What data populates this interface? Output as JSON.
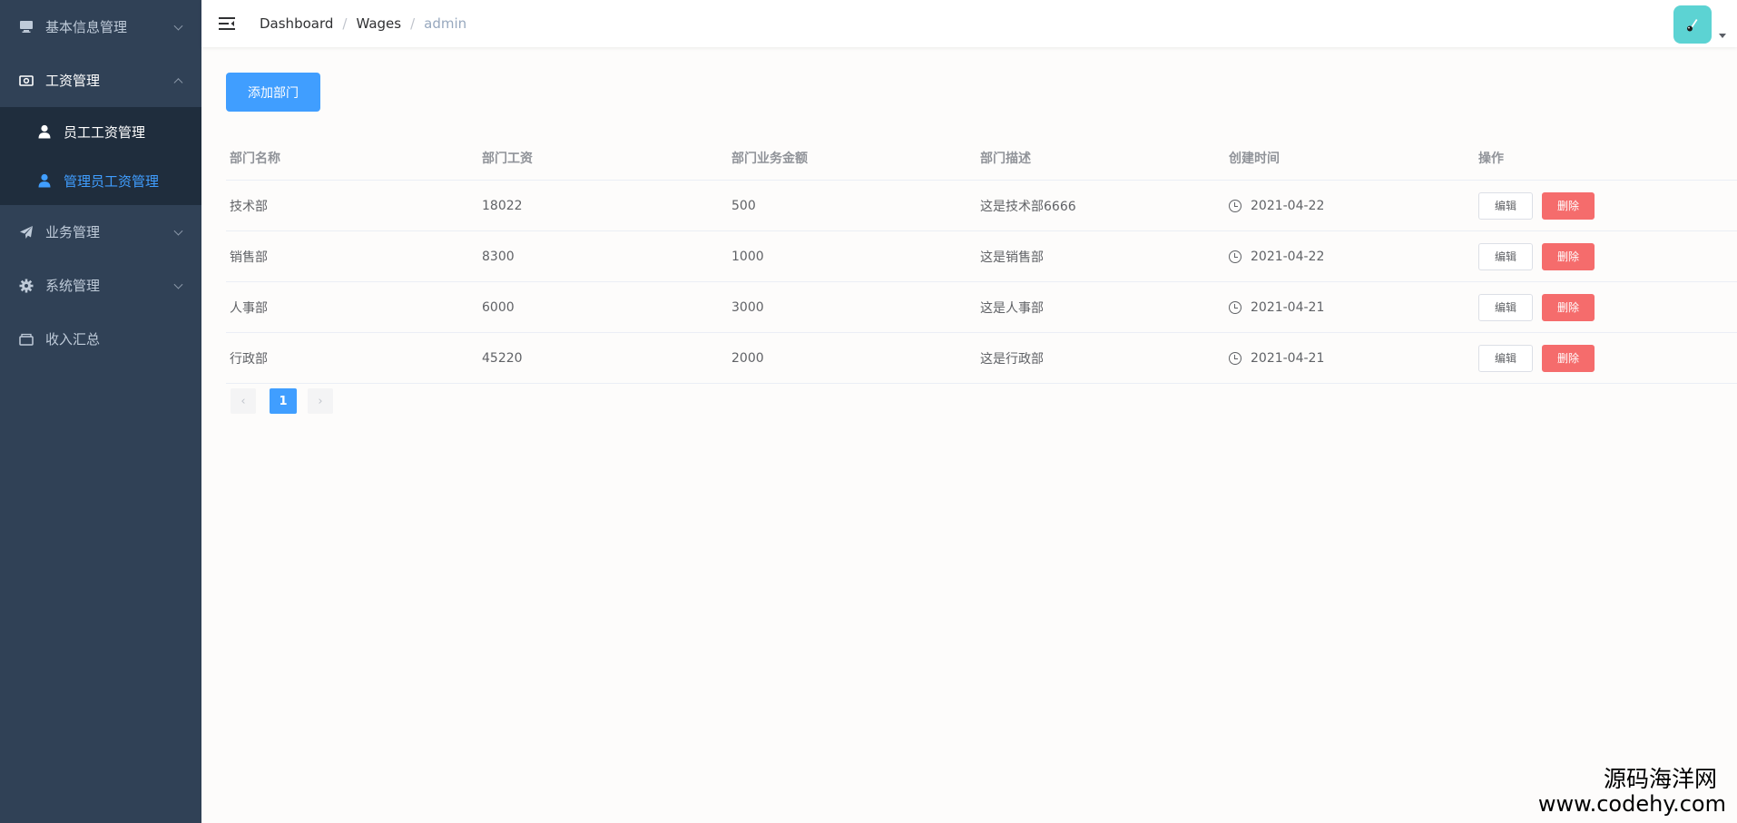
{
  "sidebar": {
    "items": [
      {
        "label": "基本信息管理",
        "icon": "monitor-icon"
      },
      {
        "label": "工资管理",
        "icon": "money-icon"
      },
      {
        "label": "员工工资管理",
        "icon": "user-icon"
      },
      {
        "label": "管理员工资管理",
        "icon": "user-icon"
      },
      {
        "label": "业务管理",
        "icon": "send-icon"
      },
      {
        "label": "系统管理",
        "icon": "gear-icon"
      },
      {
        "label": "收入汇总",
        "icon": "wallet-icon"
      }
    ]
  },
  "header": {
    "breadcrumb": [
      "Dashboard",
      "Wages",
      "admin"
    ],
    "separator": "/"
  },
  "main": {
    "add_button": "添加部门",
    "columns": [
      "部门名称",
      "部门工资",
      "部门业务金额",
      "部门描述",
      "创建时间",
      "操作"
    ],
    "edit_label": "编辑",
    "delete_label": "删除",
    "rows": [
      {
        "name": "技术部",
        "wage": "18022",
        "amount": "500",
        "desc": "这是技术部6666",
        "date": "2021-04-22"
      },
      {
        "name": "销售部",
        "wage": "8300",
        "amount": "1000",
        "desc": "这是销售部",
        "date": "2021-04-22"
      },
      {
        "name": "人事部",
        "wage": "6000",
        "amount": "3000",
        "desc": "这是人事部",
        "date": "2021-04-21"
      },
      {
        "name": "行政部",
        "wage": "45220",
        "amount": "2000",
        "desc": "这是行政部",
        "date": "2021-04-21"
      }
    ],
    "pagination": {
      "prev": "‹",
      "current": "1",
      "next": "›"
    }
  },
  "watermark": {
    "line1": "源码海洋网",
    "line2": "www.codehy.com"
  },
  "colors": {
    "sidebar_bg": "#304156",
    "submenu_bg": "#1f2d3d",
    "primary": "#409eff",
    "danger": "#f56c6c",
    "avatar": "#5cd3d3"
  }
}
